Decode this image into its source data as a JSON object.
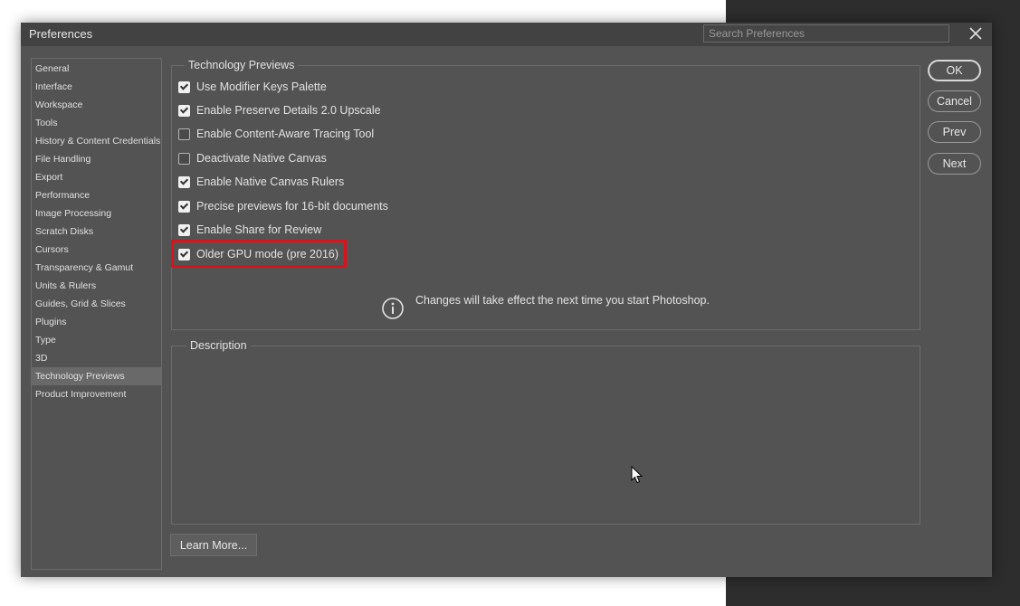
{
  "window": {
    "title": "Preferences"
  },
  "search": {
    "placeholder": "Search Preferences"
  },
  "sidebar": {
    "items": [
      {
        "label": "General"
      },
      {
        "label": "Interface"
      },
      {
        "label": "Workspace"
      },
      {
        "label": "Tools"
      },
      {
        "label": "History & Content Credentials"
      },
      {
        "label": "File Handling"
      },
      {
        "label": "Export"
      },
      {
        "label": "Performance"
      },
      {
        "label": "Image Processing"
      },
      {
        "label": "Scratch Disks"
      },
      {
        "label": "Cursors"
      },
      {
        "label": "Transparency & Gamut"
      },
      {
        "label": "Units & Rulers"
      },
      {
        "label": "Guides, Grid & Slices"
      },
      {
        "label": "Plugins"
      },
      {
        "label": "Type"
      },
      {
        "label": "3D"
      },
      {
        "label": "Technology Previews",
        "selected": true
      },
      {
        "label": "Product Improvement"
      }
    ]
  },
  "tech_previews": {
    "title": "Technology Previews",
    "options": [
      {
        "label": "Use Modifier Keys Palette",
        "checked": true
      },
      {
        "label": "Enable Preserve Details 2.0 Upscale",
        "checked": true
      },
      {
        "label": "Enable Content-Aware Tracing Tool",
        "checked": false
      },
      {
        "label": "Deactivate Native Canvas",
        "checked": false
      },
      {
        "label": "Enable Native Canvas Rulers",
        "checked": true
      },
      {
        "label": "Precise previews for 16-bit documents",
        "checked": true
      },
      {
        "label": "Enable Share for Review",
        "checked": true
      },
      {
        "label": "Older GPU mode (pre 2016)",
        "checked": true
      }
    ],
    "notice": "Changes will take effect the next time you start Photoshop."
  },
  "description": {
    "title": "Description"
  },
  "buttons": {
    "ok": "OK",
    "cancel": "Cancel",
    "prev": "Prev",
    "next": "Next",
    "learn_more": "Learn More..."
  },
  "colors": {
    "highlight": "#e0101a",
    "dialog_bg": "#535353",
    "titlebar_bg": "#424242"
  }
}
